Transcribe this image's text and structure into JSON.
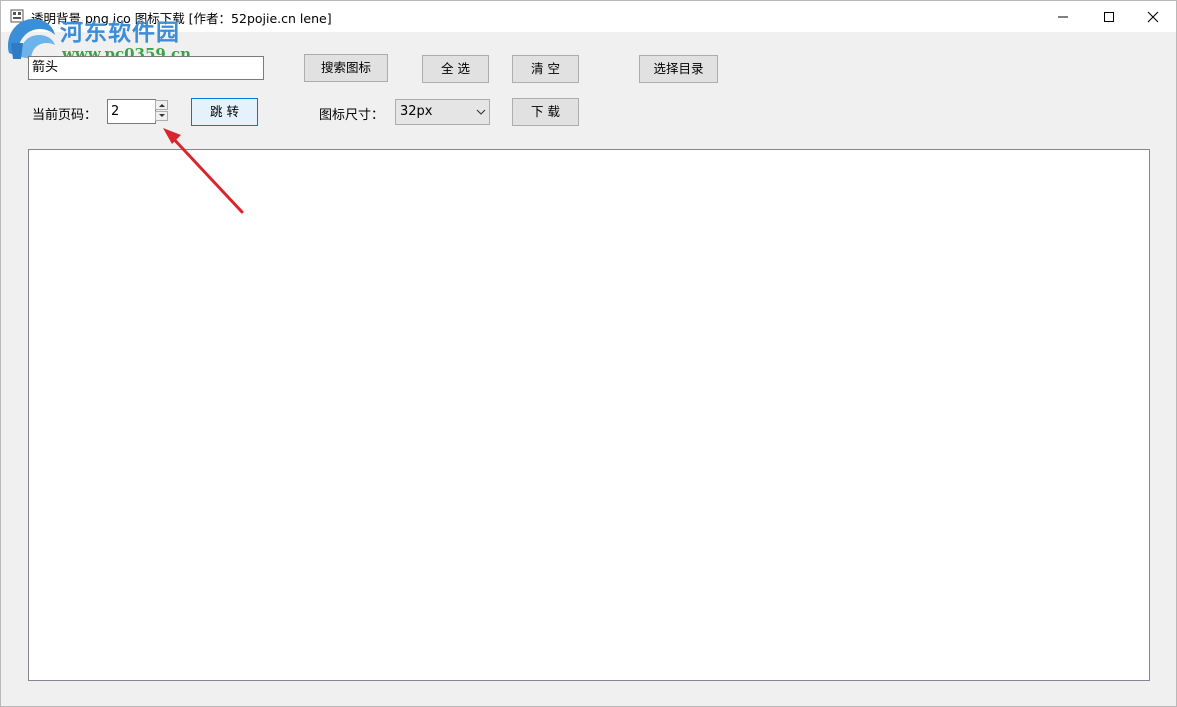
{
  "window": {
    "title": "透明背景 png ico 图标下载  [作者：52pojie.cn lene]",
    "controls": {
      "minimize_icon": "minimize-icon",
      "maximize_icon": "maximize-icon",
      "close_icon": "close-icon"
    }
  },
  "watermark": {
    "name": "河东软件园",
    "url": "www.pc0359.cn"
  },
  "search": {
    "value": "箭头",
    "button_label": "搜索图标"
  },
  "toolbar": {
    "select_all_label": "全 选",
    "clear_label": "清 空",
    "choose_dir_label": "选择目录",
    "jump_label": "跳 转",
    "download_label": "下 载"
  },
  "page": {
    "label": "当前页码：",
    "value": "2"
  },
  "icon_size": {
    "label": "图标尺寸：",
    "selected": "32px"
  },
  "colors": {
    "annotation_arrow": "#d9252b",
    "focus_border": "#0078d7"
  }
}
